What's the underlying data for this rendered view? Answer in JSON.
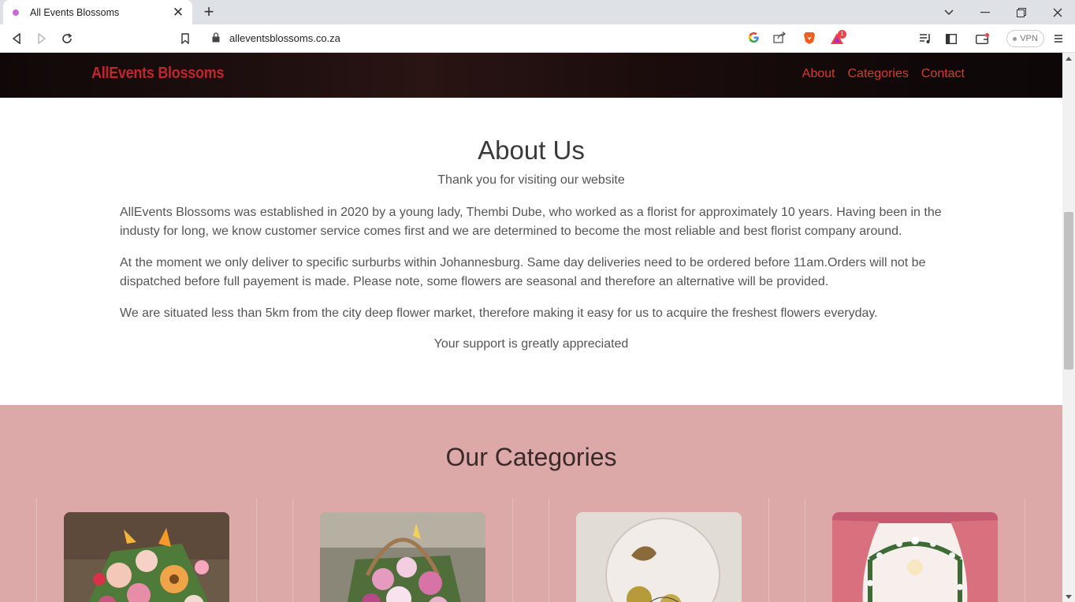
{
  "browser": {
    "tab_title": "All Events Blossoms",
    "tab_close": "✕",
    "new_tab": "+",
    "url": "alleventsblossoms.co.za",
    "vpn_label": "VPN",
    "notification_count": "1"
  },
  "nav": {
    "brand": "AllEvents Blossoms",
    "links": [
      "About",
      "Categories",
      "Contact"
    ]
  },
  "about": {
    "title": "About Us",
    "subtitle": "Thank you for visiting our website",
    "paragraphs": [
      "AllEvents Blossoms was established in 2020 by a young lady, Thembi Dube, who worked as a florist for approximately 10 years. Having been in the industy for long, we know customer service comes first and we are determined to become the most reliable and best florist company around.",
      "At the moment we only deliver to specific surburbs within Johannesburg. Same day deliveries need to be ordered before 11am.Orders will not be dispatched before full payement is made. Please note, some flowers are seasonal and therefore an alternative will be provided.",
      "We are situated less than 5km from the city deep flower market, therefore making it easy for us to acquire the freshest flowers everyday."
    ],
    "closing": "Your support is greatly appreciated"
  },
  "categories": {
    "title": "Our Categories",
    "items": [
      {
        "image": "flower-bouquet-image"
      },
      {
        "image": "flower-basket-image"
      },
      {
        "image": "birthday-balloon-image"
      },
      {
        "image": "event-decor-image"
      }
    ]
  },
  "colors": {
    "brand_red": "#c0262c",
    "nav_link": "#d93a2f",
    "categories_bg": "#dca8a8"
  }
}
